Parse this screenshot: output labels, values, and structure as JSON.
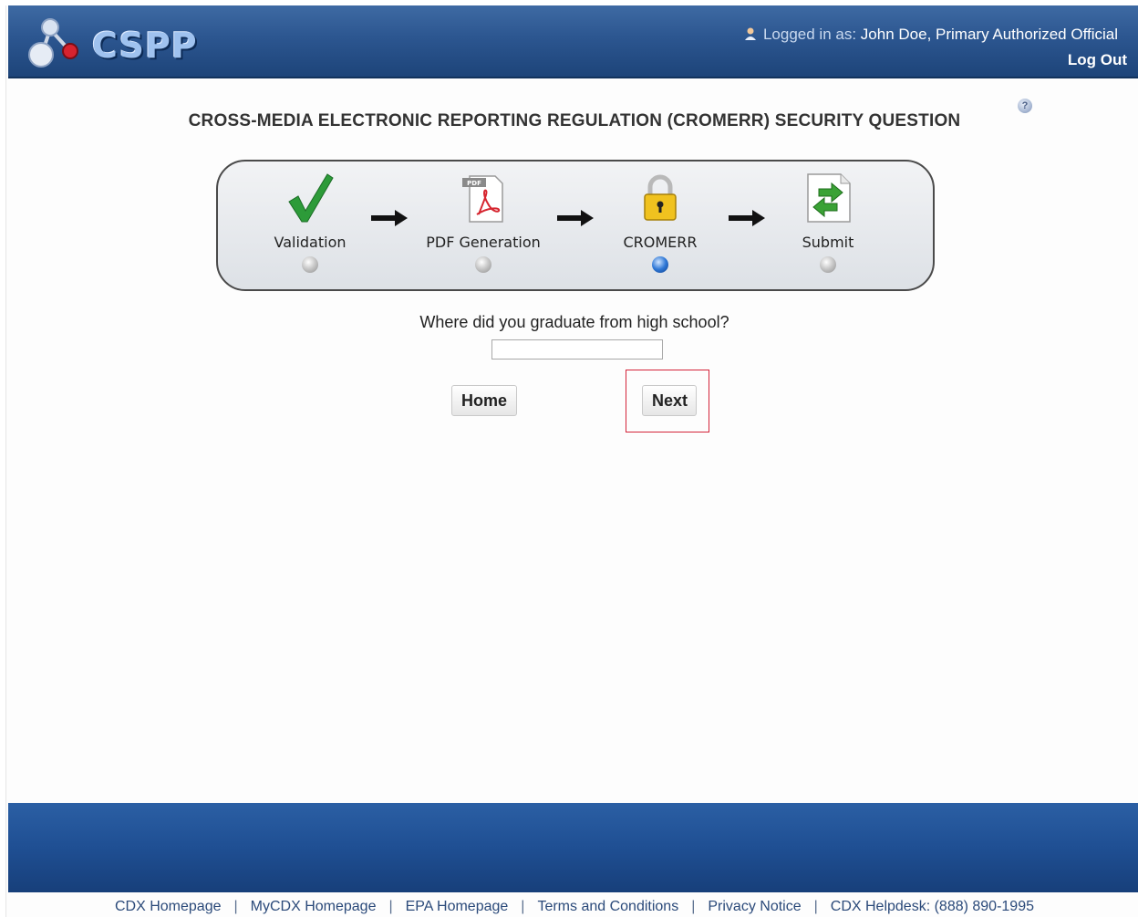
{
  "header": {
    "logo_text": "CSPP",
    "logged_in_prefix": "Logged in as:",
    "user": "John Doe, Primary Authorized Official",
    "logout_label": "Log Out"
  },
  "page": {
    "title": "CROSS-MEDIA ELECTRONIC REPORTING REGULATION (CROMERR) SECURITY QUESTION",
    "help_icon": "question-mark-icon"
  },
  "progress": {
    "steps": [
      {
        "label": "Validation",
        "icon": "green-checkmark-icon",
        "active": false
      },
      {
        "label": "PDF Generation",
        "icon": "pdf-document-icon",
        "active": false
      },
      {
        "label": "CROMERR",
        "icon": "padlock-icon",
        "active": true
      },
      {
        "label": "Submit",
        "icon": "submit-document-arrow-icon",
        "active": false
      }
    ]
  },
  "form": {
    "question": "Where did you graduate from high school?",
    "answer_value": "",
    "home_label": "Home",
    "next_label": "Next"
  },
  "footer": {
    "links": [
      "CDX Homepage",
      "MyCDX Homepage",
      "EPA Homepage",
      "Terms and Conditions",
      "Privacy Notice",
      "CDX Helpdesk: (888) 890-1995"
    ]
  }
}
